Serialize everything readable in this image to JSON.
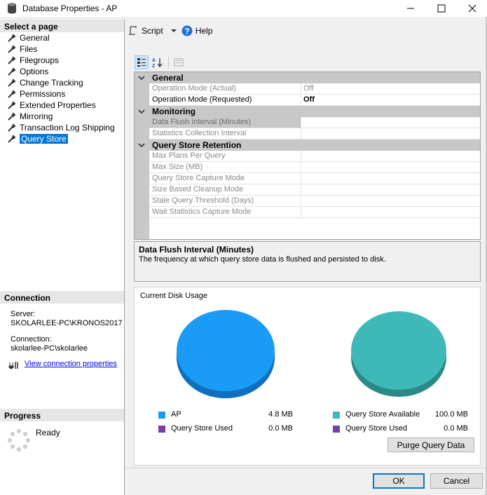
{
  "window": {
    "title": "Database Properties - AP"
  },
  "left": {
    "select_page_header": "Select a page",
    "pages": [
      {
        "label": "General"
      },
      {
        "label": "Files"
      },
      {
        "label": "Filegroups"
      },
      {
        "label": "Options"
      },
      {
        "label": "Change Tracking"
      },
      {
        "label": "Permissions"
      },
      {
        "label": "Extended Properties"
      },
      {
        "label": "Mirroring"
      },
      {
        "label": "Transaction Log Shipping"
      },
      {
        "label": "Query Store"
      }
    ],
    "selected_page": "Query Store",
    "connection_header": "Connection",
    "server_label": "Server:",
    "server_value": "SKOLARLEE-PC\\KRONOS2017",
    "connection_label": "Connection:",
    "connection_value": "skolarlee-PC\\skolarlee",
    "view_link": "View connection properties",
    "progress_header": "Progress",
    "progress_status": "Ready"
  },
  "toolbar": {
    "script_label": "Script",
    "help_label": "Help"
  },
  "grid": {
    "categories": [
      {
        "label": "General",
        "rows": [
          {
            "name": "Operation Mode (Actual)",
            "value": "Off"
          },
          {
            "name": "Operation Mode (Requested)",
            "value": "Off"
          }
        ]
      },
      {
        "label": "Monitoring",
        "rows": [
          {
            "name": "Data Flush Interval (Minutes)",
            "value": ""
          },
          {
            "name": "Statistics Collection Interval",
            "value": ""
          }
        ]
      },
      {
        "label": "Query Store Retention",
        "rows": [
          {
            "name": "Max Plans Per Query",
            "value": ""
          },
          {
            "name": "Max Size (MB)",
            "value": ""
          },
          {
            "name": "Query Store Capture Mode",
            "value": ""
          },
          {
            "name": "Size Based Cleanup Mode",
            "value": ""
          },
          {
            "name": "Stale Query Threshold (Days)",
            "value": ""
          },
          {
            "name": "Wait Statistics Capture Mode",
            "value": ""
          }
        ]
      }
    ]
  },
  "description": {
    "title": "Data Flush Interval (Minutes)",
    "text": "The frequency at which query store data is flushed and persisted to disk."
  },
  "disk": {
    "title": "Current Disk Usage",
    "left_legend": [
      {
        "label": "AP",
        "value": "4.8 MB",
        "color": "#1a9bf5"
      },
      {
        "label": "Query Store Used",
        "value": "0.0 MB",
        "color": "#7a3fa3"
      }
    ],
    "right_legend": [
      {
        "label": "Query Store Available",
        "value": "100.0 MB",
        "color": "#3fb8b8"
      },
      {
        "label": "Query Store Used",
        "value": "0.0 MB",
        "color": "#7a3fa3"
      }
    ],
    "purge_label": "Purge Query Data"
  },
  "buttons": {
    "ok": "OK",
    "cancel": "Cancel"
  },
  "colors": {
    "accent": "#0078d7",
    "pie_left": "#1a9bf5",
    "pie_right": "#3fb8b8",
    "purple": "#7a3fa3"
  }
}
